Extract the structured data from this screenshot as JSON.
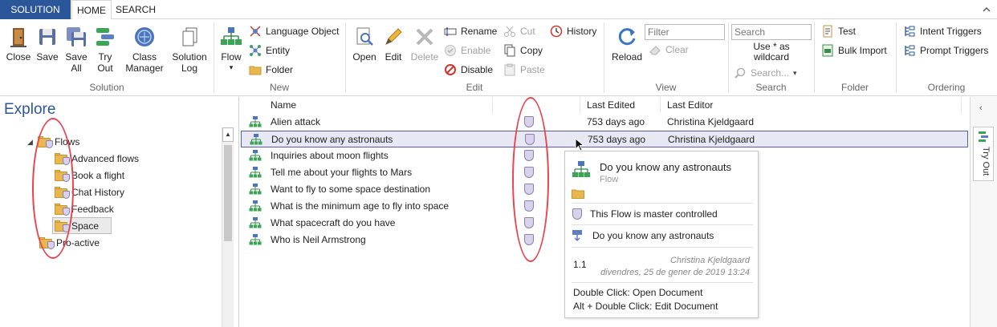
{
  "tabs": {
    "solution": "SOLUTION",
    "home": "HOME",
    "search": "SEARCH"
  },
  "ribbon": {
    "solution_group": {
      "label": "Solution",
      "close": "Close",
      "save": "Save",
      "save_all_1": "Save",
      "save_all_2": "All",
      "try_out_1": "Try",
      "try_out_2": "Out",
      "class_manager_1": "Class",
      "class_manager_2": "Manager",
      "solution_log_1": "Solution",
      "solution_log_2": "Log"
    },
    "new_group": {
      "label": "New",
      "flow": "Flow",
      "language_object": "Language Object",
      "entity": "Entity",
      "folder": "Folder"
    },
    "edit_group": {
      "label": "Edit",
      "open": "Open",
      "edit": "Edit",
      "delete": "Delete",
      "rename": "Rename",
      "enable": "Enable",
      "disable": "Disable",
      "cut": "Cut",
      "copy": "Copy",
      "paste": "Paste",
      "history": "History"
    },
    "view_group": {
      "label": "View",
      "reload": "Reload",
      "filter_placeholder": "Filter",
      "clear": "Clear"
    },
    "search_group": {
      "label": "Search",
      "search_placeholder": "Search",
      "wildcard_1": "Use * as",
      "wildcard_2": "wildcard",
      "search_dropdown": "Search..."
    },
    "folder_group": {
      "label": "Folder",
      "test": "Test",
      "bulk_import": "Bulk Import"
    },
    "ordering_group": {
      "label": "Ordering",
      "intent_triggers": "Intent Triggers",
      "prompt_triggers": "Prompt Triggers"
    }
  },
  "explore": {
    "title": "Explore",
    "tree": {
      "root": "Flows",
      "children": [
        "Advanced flows",
        "Book a flight",
        "Chat History",
        "Feedback",
        "Space"
      ],
      "sibling": "Pro-active"
    }
  },
  "list": {
    "columns": {
      "name": "Name",
      "last_edited": "Last Edited",
      "last_editor": "Last Editor"
    },
    "rows": [
      {
        "name": "Alien attack",
        "edited": "753 days ago",
        "editor": "Christina Kjeldgaard"
      },
      {
        "name": "Do you know any astronauts",
        "edited": "753 days ago",
        "editor": "Christina Kjeldgaard"
      },
      {
        "name": "Inquiries about moon flights",
        "edited": "",
        "editor": ""
      },
      {
        "name": "Tell me about your flights to Mars",
        "edited": "",
        "editor": ""
      },
      {
        "name": "Want to fly to some space destination",
        "edited": "",
        "editor": ""
      },
      {
        "name": "What is the minimum age to fly into space",
        "edited": "",
        "editor": ""
      },
      {
        "name": "What spacecraft do you have",
        "edited": "",
        "editor": ""
      },
      {
        "name": "Who is Neil Armstrong",
        "edited": "",
        "editor": ""
      }
    ]
  },
  "tooltip": {
    "title": "Do you know any astronauts",
    "type": "Flow",
    "master_controlled": "This Flow is master controlled",
    "trigger": "Do you know any astronauts",
    "version": "1.1",
    "editor": "Christina Kjeldgaard",
    "date": "divendres, 25 de gener de 2019 13:24",
    "hint_open": "Double Click: Open Document",
    "hint_edit": "Alt + Double Click: Edit Document"
  },
  "right_panel": {
    "try_out": "Try Out"
  },
  "colors": {
    "accent": "#2b579a",
    "annotation": "#e8444f",
    "shield": "#d8d2ea",
    "folder": "#e8b74f"
  }
}
